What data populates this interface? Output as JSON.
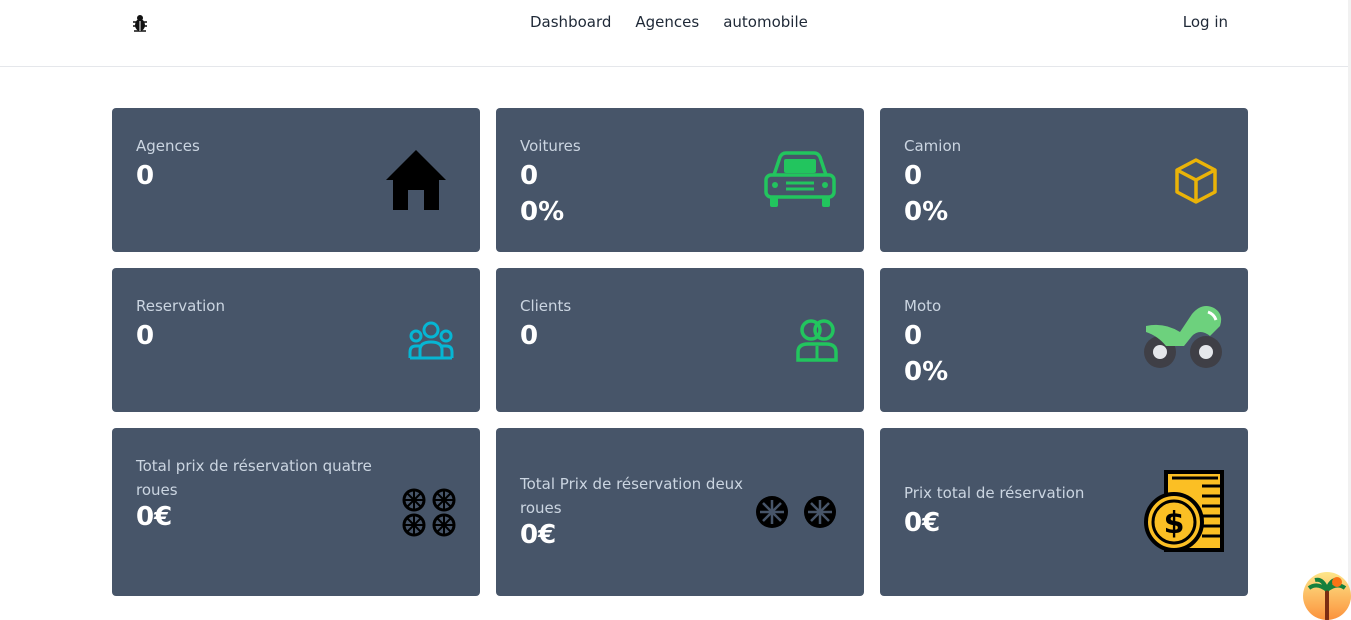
{
  "nav": {
    "links": [
      "Dashboard",
      "Agences",
      "automobile"
    ],
    "login": "Log in"
  },
  "cards": [
    {
      "label": "Agences",
      "value": "0",
      "icon": "house-icon",
      "icon_color": "#000000"
    },
    {
      "label": "Voitures",
      "value": "0",
      "percent": "0%",
      "icon": "car-icon",
      "icon_color": "#22c55e"
    },
    {
      "label": "Camion",
      "value": "0",
      "percent": "0%",
      "icon": "cube-icon",
      "icon_color": "#eab308"
    },
    {
      "label": "Reservation",
      "value": "0",
      "icon": "users-group-icon",
      "icon_color": "#06b6d4"
    },
    {
      "label": "Clients",
      "value": "0",
      "icon": "users-icon",
      "icon_color": "#22c55e"
    },
    {
      "label": "Moto",
      "value": "0",
      "percent": "0%",
      "icon": "motorcycle-icon",
      "icon_color": "#6dd17d"
    },
    {
      "label": "Total prix de réservation quatre roues",
      "value": "0€",
      "icon": "four-wheels-icon",
      "icon_color": "#000000"
    },
    {
      "label": "Total Prix de réservation deux roues",
      "value": "0€",
      "icon": "two-wheels-icon",
      "icon_color": "#000000"
    },
    {
      "label": "Prix total de réservation",
      "value": "0€",
      "icon": "dollar-coin-icon",
      "icon_color": "#fbbf24"
    }
  ]
}
